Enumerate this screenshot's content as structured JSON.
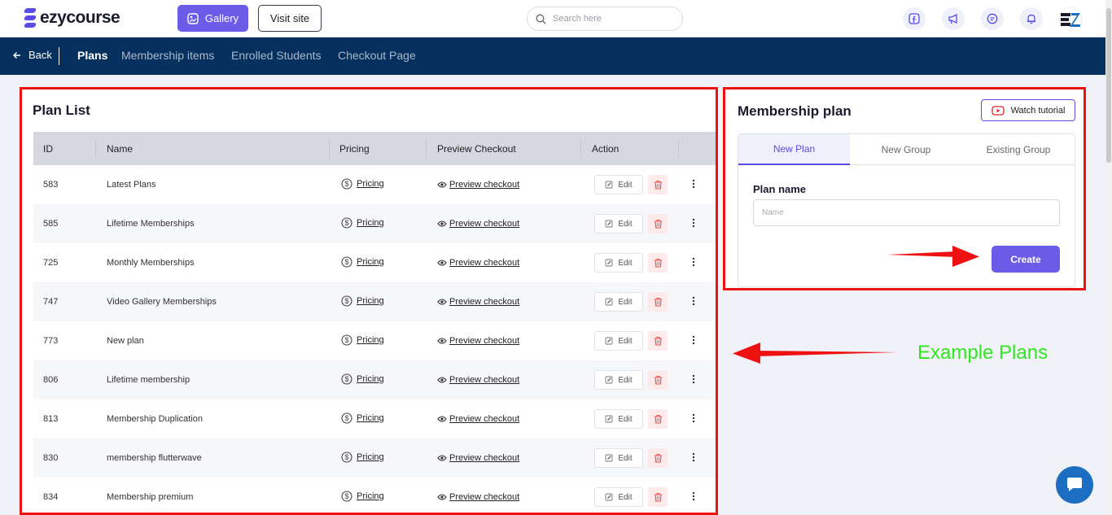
{
  "header": {
    "brand": "ezycourse",
    "gallery_label": "Gallery",
    "visit_site_label": "Visit site",
    "search_placeholder": "Search here"
  },
  "nav": {
    "back_label": "Back",
    "tabs": [
      "Plans",
      "Membership items",
      "Enrolled Students",
      "Checkout Page"
    ],
    "active_tab": "Plans"
  },
  "plan_list": {
    "title": "Plan List",
    "columns": [
      "ID",
      "Name",
      "Pricing",
      "Preview Checkout",
      "Action"
    ],
    "pricing_label": "Pricing",
    "preview_label": "Preview checkout",
    "edit_label": "Edit",
    "rows": [
      {
        "id": "583",
        "name": "Latest Plans"
      },
      {
        "id": "585",
        "name": "Lifetime Memberships"
      },
      {
        "id": "725",
        "name": "Monthly Memberships"
      },
      {
        "id": "747",
        "name": "Video Gallery Memberships"
      },
      {
        "id": "773",
        "name": "New plan"
      },
      {
        "id": "806",
        "name": "Lifetime membership"
      },
      {
        "id": "813",
        "name": "Membership Duplication"
      },
      {
        "id": "830",
        "name": "membership flutterwave"
      },
      {
        "id": "834",
        "name": "Membership premium"
      }
    ]
  },
  "membership_plan": {
    "title": "Membership plan",
    "watch_tutorial_label": "Watch tutorial",
    "tabs": [
      "New Plan",
      "New Group",
      "Existing Group"
    ],
    "active_tab": "New Plan",
    "field_label": "Plan name",
    "name_placeholder": "Name",
    "name_value": "",
    "create_label": "Create"
  },
  "annotation": {
    "text": "Example Plans",
    "highlight_color": "#ee1111",
    "text_color": "#2ee81f"
  },
  "colors": {
    "accent": "#6b5ce7",
    "navbar": "#06315e"
  }
}
